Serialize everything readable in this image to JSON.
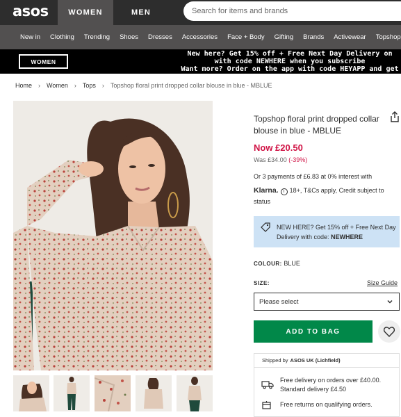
{
  "header": {
    "logo": "asos",
    "tabs": [
      "WOMEN",
      "MEN"
    ],
    "search_placeholder": "Search for items and brands"
  },
  "nav": {
    "items": [
      "New in",
      "Clothing",
      "Trending",
      "Shoes",
      "Dresses",
      "Accessories",
      "Face + Body",
      "Gifting",
      "Brands",
      "Activewear",
      "Topshop"
    ]
  },
  "promo": {
    "button": "WOMEN",
    "line1": "New here? Get 15% off + Free Next Day Delivery on",
    "line2": "with code NEWHERE when you subscribe",
    "line3": "Want more? Order on the app with code HEYAPP and get"
  },
  "breadcrumb": [
    "Home",
    "Women",
    "Tops",
    "Topshop floral print dropped collar blouse in blue - MBLUE"
  ],
  "product": {
    "title": "Topshop floral print dropped collar blouse in blue - MBLUE",
    "price_now": "Now £20.50",
    "price_was": "Was £34.00",
    "discount": "(-39%)",
    "klarna_line1": "Or 3 payments of £6.83 at 0% interest with",
    "klarna_brand": "Klarna.",
    "klarna_line2": "18+, T&Cs apply, Credit subject to",
    "klarna_line3": "status",
    "offer_text": "NEW HERE? Get 15% off + Free Next Day Delivery with code:",
    "offer_code": "NEWHERE",
    "colour_label": "COLOUR:",
    "colour_value": "BLUE",
    "size_label": "SIZE:",
    "size_guide": "Size Guide",
    "size_select": "Please select",
    "add_to_bag": "ADD TO BAG"
  },
  "shipping": {
    "shipped_by_label": "Shipped by",
    "shipped_by_value": "ASOS UK (Lichfield)",
    "delivery_line1": "Free delivery on orders over £40.00.",
    "delivery_line2": "Standard delivery £4.50",
    "returns": "Free returns on qualifying orders."
  },
  "colors": {
    "header_bg": "#2d2d2d",
    "nav_bg": "#525050",
    "price_red": "#d01345",
    "add_green": "#018849",
    "offer_blue": "#cde2f5"
  },
  "icons": [
    "share-icon",
    "tag-icon",
    "chevron-down-icon",
    "heart-icon",
    "truck-icon",
    "returns-icon",
    "info-icon"
  ]
}
